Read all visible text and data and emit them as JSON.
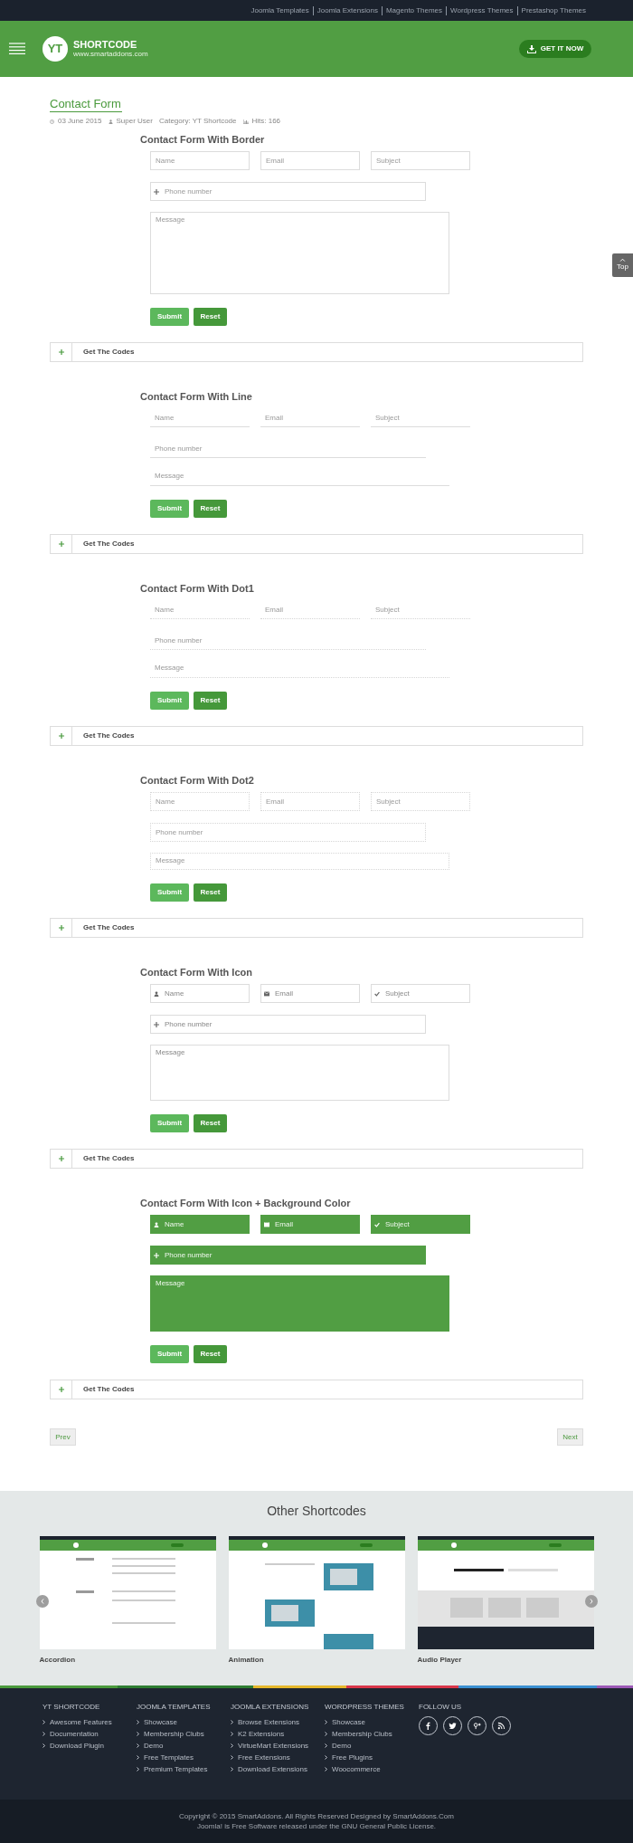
{
  "top_links": [
    "Joomla Templates",
    "Joomla Extensions",
    "Magento Themes",
    "Wordpress Themes",
    "Prestashop Themes"
  ],
  "header": {
    "logo_mark": "YT",
    "site_name": "SHORTCODE",
    "site_url": "www.smartaddons.com",
    "cta": "GET IT NOW"
  },
  "article": {
    "title": "Contact Form",
    "meta": {
      "date": "03 June 2015",
      "author": "Super User",
      "category": "Category: YT Shortcode",
      "hits": "Hits: 166"
    }
  },
  "forms": [
    {
      "kind": "border",
      "title": "Contact Form With Border",
      "fields": [
        {
          "placeholder": "Name"
        },
        {
          "placeholder": "Email"
        },
        {
          "placeholder": "Subject"
        }
      ],
      "phone": {
        "placeholder": "Phone number"
      },
      "message": {
        "placeholder": "Message"
      },
      "buttons": [
        "Submit",
        "Reset"
      ],
      "codes": "Get The Codes"
    },
    {
      "kind": "line",
      "title": "Contact Form With Line",
      "fields": [
        {
          "placeholder": "Name"
        },
        {
          "placeholder": "Email"
        },
        {
          "placeholder": "Subject"
        }
      ],
      "phone": {
        "placeholder": "Phone number"
      },
      "message": {
        "placeholder": "Message"
      },
      "buttons": [
        "Submit",
        "Reset"
      ],
      "codes": "Get The Codes"
    },
    {
      "kind": "dot1",
      "title": "Contact Form With Dot1",
      "fields": [
        {
          "placeholder": "Name"
        },
        {
          "placeholder": "Email"
        },
        {
          "placeholder": "Subject"
        }
      ],
      "phone": {
        "placeholder": "Phone number"
      },
      "message": {
        "placeholder": "Message"
      },
      "buttons": [
        "Submit",
        "Reset"
      ],
      "codes": "Get The Codes"
    },
    {
      "kind": "dot2",
      "title": "Contact Form With Dot2",
      "fields": [
        {
          "placeholder": "Name"
        },
        {
          "placeholder": "Email"
        },
        {
          "placeholder": "Subject"
        }
      ],
      "phone": {
        "placeholder": "Phone number"
      },
      "message": {
        "placeholder": "Message"
      },
      "buttons": [
        "Submit",
        "Reset"
      ],
      "codes": "Get The Codes"
    },
    {
      "kind": "icon",
      "title": "Contact Form With Icon",
      "fields": [
        {
          "placeholder": "Name"
        },
        {
          "placeholder": "Email"
        },
        {
          "placeholder": "Subject"
        }
      ],
      "phone": {
        "placeholder": "Phone number"
      },
      "message": {
        "placeholder": "Message"
      },
      "buttons": [
        "Submit",
        "Reset"
      ],
      "codes": "Get The Codes"
    },
    {
      "kind": "icon-bg",
      "title": "Contact Form With Icon + Background Color",
      "fields": [
        {
          "placeholder": "Name"
        },
        {
          "placeholder": "Email"
        },
        {
          "placeholder": "Subject"
        }
      ],
      "phone": {
        "placeholder": "Phone number"
      },
      "message": {
        "placeholder": "Message"
      },
      "buttons": [
        "Submit",
        "Reset"
      ],
      "codes": "Get The Codes"
    }
  ],
  "pager": {
    "prev": "Prev",
    "next": "Next"
  },
  "back_to_top": "Top",
  "other_shortcodes": {
    "title": "Other Shortcodes",
    "items": [
      {
        "label": "Accordion",
        "kind": "picture"
      },
      {
        "label": "Animation",
        "kind": "picture"
      },
      {
        "label": "Audio Player",
        "kind": "picture"
      }
    ]
  },
  "footer": {
    "columns": [
      {
        "heading": "YT SHORTCODE",
        "links": [
          "Awesome Features",
          "Documentation",
          "Download Plugin"
        ]
      },
      {
        "heading": "JOOMLA TEMPLATES",
        "links": [
          "Showcase",
          "Membership Clubs",
          "Demo",
          "Free Templates",
          "Premium Templates"
        ]
      },
      {
        "heading": "JOOMLA EXTENSIONS",
        "links": [
          "Browse Extensions",
          "K2 Extensions",
          "VirtueMart Extensions",
          "Free Extensions",
          "Download Extensions"
        ]
      },
      {
        "heading": "WORDPRESS THEMES",
        "links": [
          "Showcase",
          "Membership Clubs",
          "Demo",
          "Free Plugins",
          "Woocommerce"
        ]
      }
    ],
    "follow_heading": "FOLLOW US",
    "copyright": [
      "Copyright © 2015 SmartAddons. All Rights Reserved Designed by SmartAddons.Com",
      "Joomla! is Free Software released under the GNU General Public License."
    ]
  }
}
